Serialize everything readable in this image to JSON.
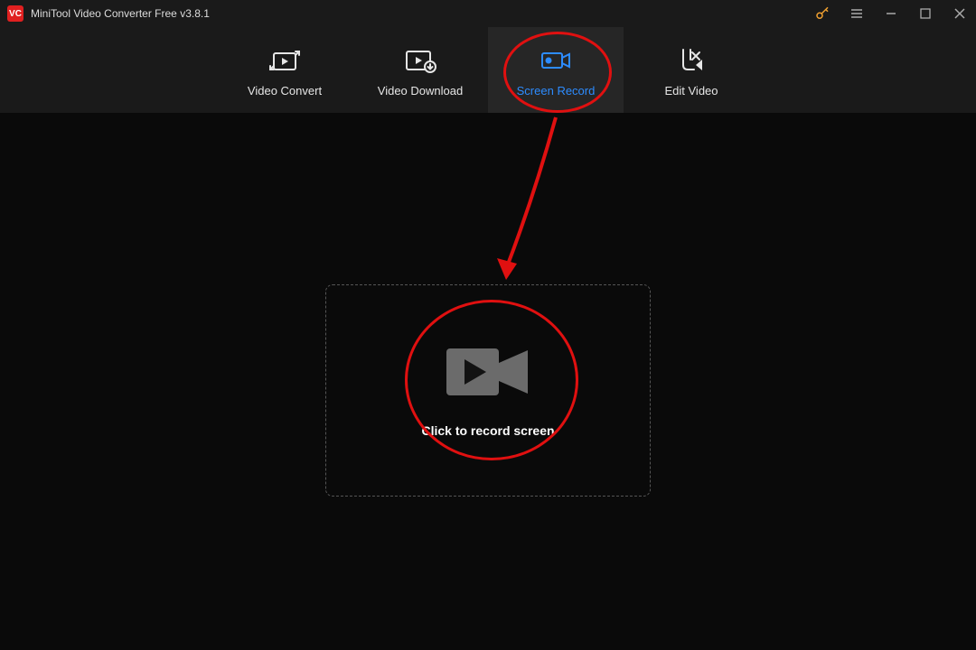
{
  "title": "MiniTool Video Converter Free v3.8.1",
  "tabs": {
    "convert": "Video Convert",
    "download": "Video Download",
    "record": "Screen Record",
    "edit": "Edit Video"
  },
  "record_prompt": "Click to record screen",
  "annotations": {
    "highlight_tab": "screen-record-tab",
    "highlight_action": "record-button"
  }
}
